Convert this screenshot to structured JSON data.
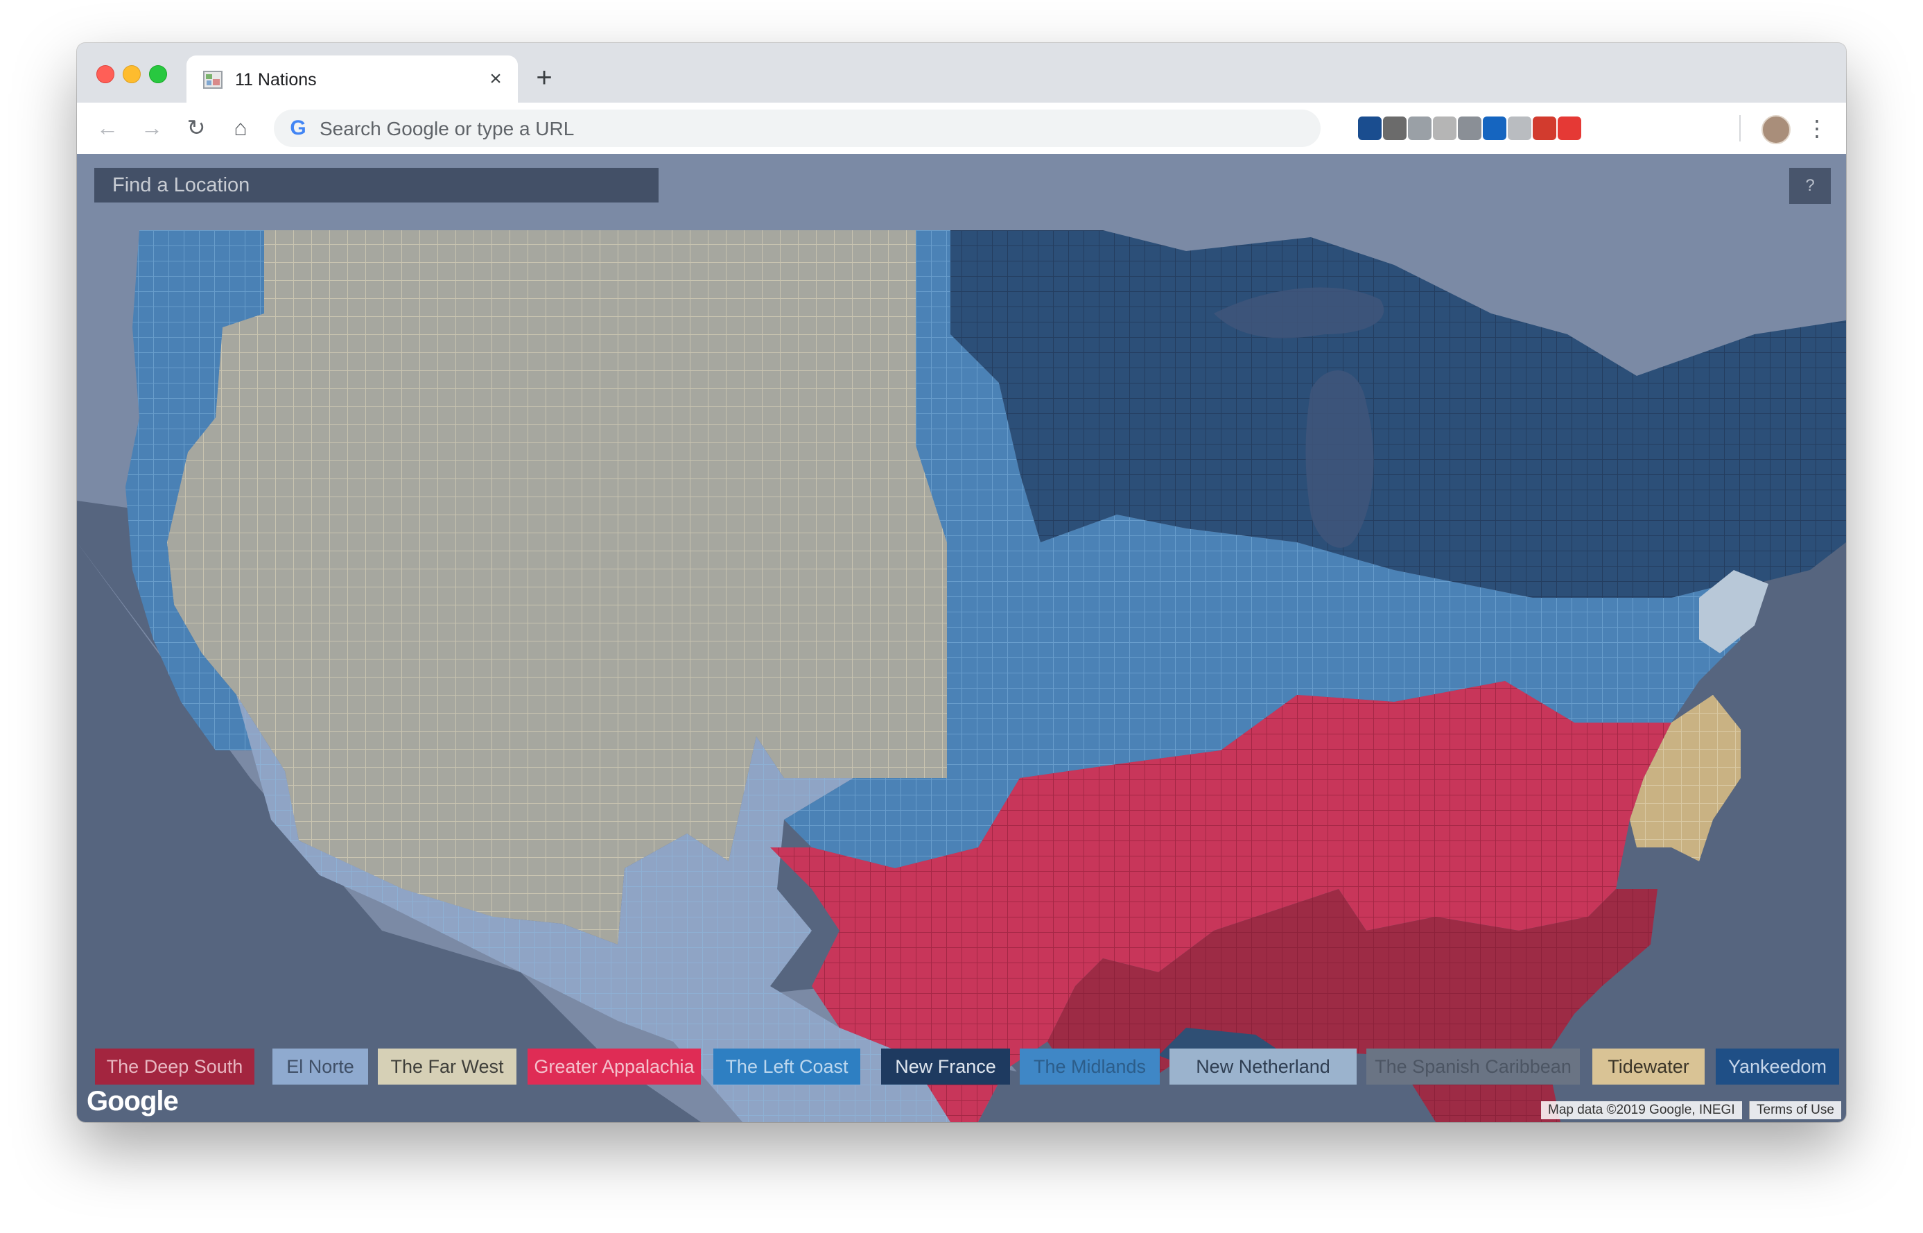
{
  "window": {
    "tab_title": "11 Nations",
    "new_tab_symbol": "+",
    "close_symbol": "×"
  },
  "toolbar": {
    "omnibox_placeholder": "Search Google or type a URL",
    "back_symbol": "←",
    "forward_symbol": "→",
    "reload_symbol": "↻",
    "home_symbol": "⌂",
    "menu_symbol": "⋮",
    "extensions": [
      {
        "icon": "bar-chart-icon",
        "color": "#1a4d8f"
      },
      {
        "icon": "pinterest-icon",
        "color": "#6b6b6b"
      },
      {
        "icon": "drive-icon",
        "color": "#9aa0a6"
      },
      {
        "icon": "r-letter-icon",
        "color": "#b5b5b5"
      },
      {
        "icon": "circle-face-icon",
        "color": "#8a8f96"
      },
      {
        "icon": "bookmark-blue-icon",
        "color": "#1565c0"
      },
      {
        "icon": "printer-icon",
        "color": "#b9bcc0"
      },
      {
        "icon": "heart-box-icon",
        "color": "#d23b2e"
      },
      {
        "icon": "hand-stop-icon",
        "color": "#e53935"
      }
    ]
  },
  "map": {
    "search_placeholder": "Find a Location",
    "help_label": "?",
    "google_logo": "Google",
    "attribution": "Map data ©2019 Google, INEGI",
    "terms": "Terms of Use",
    "colors": {
      "water": "#56657f",
      "land": "#7b8aa5",
      "far_west": "#a6a79f",
      "left_coast": "#4a81b5",
      "el_norte": "#8fa4c5",
      "midlands": "#4b82b6",
      "yankeedom": "#2c4f78",
      "greater_appalachia": "#c8365a",
      "deep_south": "#9d2b45",
      "tidewater": "#c9b283",
      "new_netherland": "#b8c8d8",
      "new_france": "#2f4f74"
    }
  },
  "legend": [
    {
      "label": "The Deep South",
      "bg": "#a3253f",
      "fg": "#e8b7c1"
    },
    {
      "label": "El Norte",
      "bg": "#8faacf",
      "fg": "#3f4f66"
    },
    {
      "label": "The Far West",
      "bg": "#d6d0b6",
      "fg": "#3f3f3a"
    },
    {
      "label": "Greater Appalachia",
      "bg": "#df2c55",
      "fg": "#f4c1cc"
    },
    {
      "label": "The Left Coast",
      "bg": "#2e7fc2",
      "fg": "#bcd7ee"
    },
    {
      "label": "New France",
      "bg": "#1e3a60",
      "fg": "#dfe6ef"
    },
    {
      "label": "The Midlands",
      "bg": "#3f87c6",
      "fg": "#2c5d8a"
    },
    {
      "label": "New Netherland",
      "bg": "#9bb3cd",
      "fg": "#2f3e52"
    },
    {
      "label": "The Spanish Caribbean",
      "bg": "#6a7484",
      "fg": "#4c5563"
    },
    {
      "label": "Tidewater",
      "bg": "#d9c395",
      "fg": "#3b3528"
    },
    {
      "label": "Yankeedom",
      "bg": "#1f4f86",
      "fg": "#c6d6ea"
    }
  ]
}
